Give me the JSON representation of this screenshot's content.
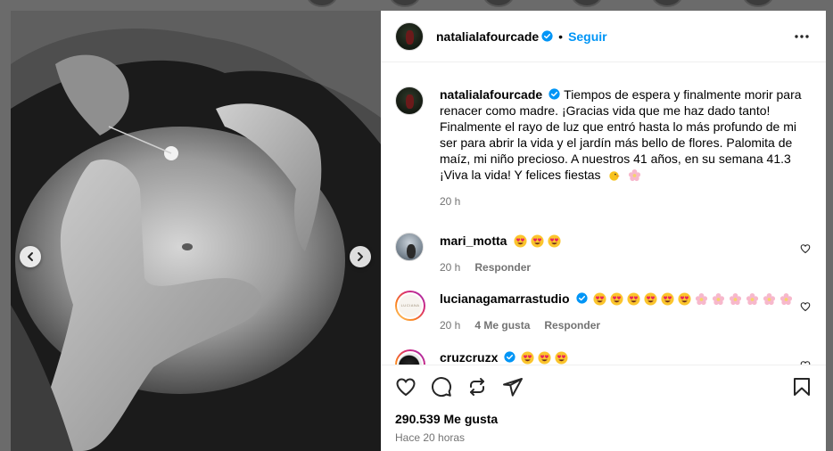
{
  "post": {
    "author": "natalialafourcade",
    "follow_label": "Seguir",
    "separator": "•",
    "caption": "Tiempos de espera y finalmente morir para renacer como madre. ¡Gracias vida que me haz dado tanto! Finalmente el rayo de luz que entró hasta lo más profundo de mi ser para abrir la vida y el jardín más bello de flores. Palomita de maíz, mi niño precioso. A nuestros 41 años, en su semana 41.3 ¡Viva la vida! Y felices fiestas",
    "caption_emojis": [
      "chick-emoji",
      "blossom-emoji"
    ],
    "caption_time": "20 h",
    "likes": "290.539 Me gusta",
    "time_ago": "Hace 20 horas"
  },
  "comments": [
    {
      "username": "mari_motta",
      "verified": false,
      "emojis": [
        "heart-eyes-emoji",
        "heart-eyes-emoji",
        "heart-eyes-emoji"
      ],
      "time": "20 h",
      "likes": "",
      "reply_label": "Responder"
    },
    {
      "username": "lucianagamarrastudio",
      "verified": true,
      "avatar_text": "LUCIANA GAMARRA",
      "emojis": [
        "heart-eyes-emoji",
        "heart-eyes-emoji",
        "heart-eyes-emoji",
        "heart-eyes-emoji",
        "heart-eyes-emoji",
        "heart-eyes-emoji",
        "blossom-emoji",
        "blossom-emoji",
        "blossom-emoji",
        "blossom-emoji",
        "blossom-emoji",
        "blossom-emoji"
      ],
      "time": "20 h",
      "likes": "4 Me gusta",
      "reply_label": "Responder"
    },
    {
      "username": "cruzcruzx",
      "verified": true,
      "emojis": [
        "heart-eyes-emoji",
        "heart-eyes-emoji",
        "heart-eyes-emoji"
      ],
      "time": "",
      "likes": "",
      "reply_label": ""
    }
  ],
  "colors": {
    "accent": "#0095f6",
    "muted": "#737373",
    "backdrop": "#6b6b6b"
  },
  "icons": [
    "heart-icon",
    "comment-icon",
    "share-icon",
    "send-icon",
    "bookmark-icon",
    "more-icon",
    "chevron-left-icon",
    "chevron-right-icon",
    "verified-badge-icon"
  ]
}
